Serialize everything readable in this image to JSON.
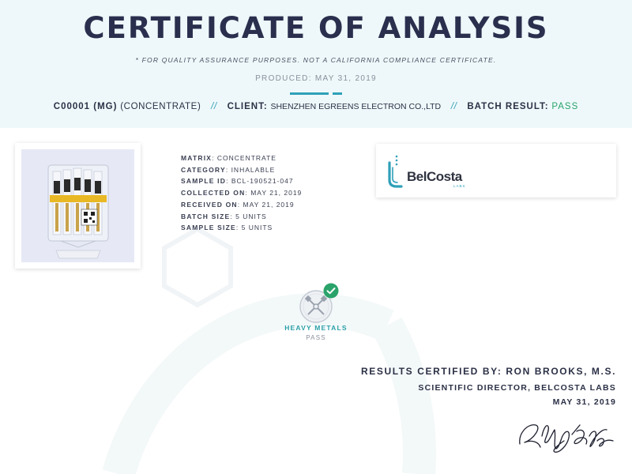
{
  "header": {
    "title": "CERTIFICATE OF ANALYSIS",
    "disclaimer": "* FOR QUALITY ASSURANCE PURPOSES. NOT A CALIFORNIA COMPLIANCE CERTIFICATE.",
    "produced": "PRODUCED: MAY 31, 2019",
    "accent_color": "#2fa0b8"
  },
  "summary": {
    "sample_code": "C00001 (MG)",
    "sample_type": "(CONCENTRATE)",
    "separator": "//",
    "client_label": "CLIENT:",
    "client_value": "SHENZHEN EGREENS ELECTRON CO.,LTD",
    "batch_label": "BATCH RESULT:",
    "batch_value": "PASS",
    "pass_color": "#2aa36b"
  },
  "photo": {
    "icon": "product-photo-cartridges"
  },
  "details": [
    {
      "key": "MATRIX",
      "value": "CONCENTRATE"
    },
    {
      "key": "CATEGORY",
      "value": "INHALABLE"
    },
    {
      "key": "SAMPLE ID",
      "value": "BCL-190521-047"
    },
    {
      "key": "COLLECTED ON",
      "value": "MAY 21, 2019"
    },
    {
      "key": "RECEIVED ON",
      "value": "MAY 21, 2019"
    },
    {
      "key": "BATCH SIZE",
      "value": "5 UNITS"
    },
    {
      "key": "SAMPLE SIZE",
      "value": "5 UNITS"
    }
  ],
  "lab_logo": {
    "name": "BelCosta",
    "sub": "LABS",
    "icon": "belcosta-logo-mark"
  },
  "tests": [
    {
      "name": "HEAVY METALS",
      "status": "PASS",
      "icon": "heavy-metals-icon"
    }
  ],
  "certification": {
    "line1": "RESULTS CERTIFIED BY: RON BROOKS, M.S.",
    "line2": "SCIENTIFIC DIRECTOR, BELCOSTA LABS",
    "line3": "MAY 31, 2019"
  }
}
